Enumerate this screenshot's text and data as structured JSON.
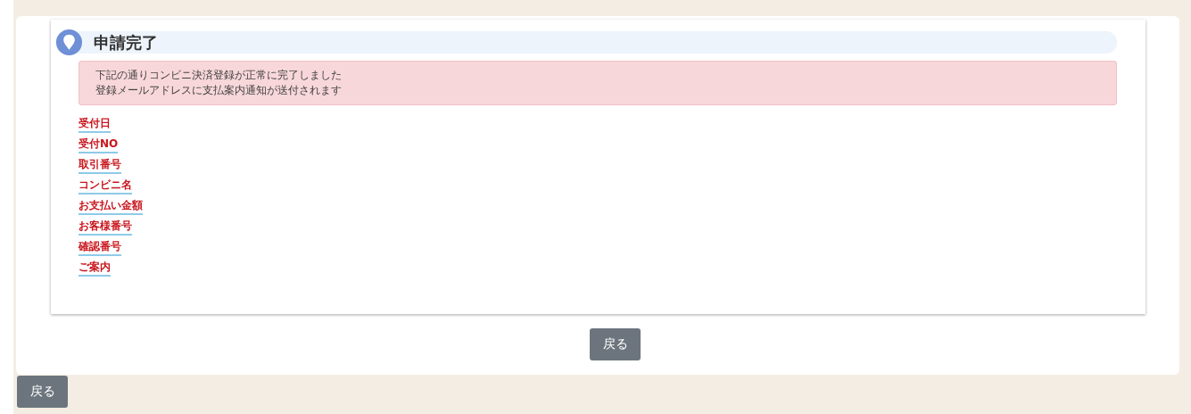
{
  "heading": "申請完了",
  "alert": [
    "下記の通りコンビニ決済登録が正常に完了しました",
    "登録メールアドレスに支払案内通知が送付されます"
  ],
  "fields": [
    "受付日",
    "受付NO",
    "取引番号",
    "コンビニ名",
    "お支払い金額",
    "お客様番号",
    "確認番号",
    "ご案内"
  ],
  "back_button": "戻る",
  "footer_back_button": "戻る"
}
